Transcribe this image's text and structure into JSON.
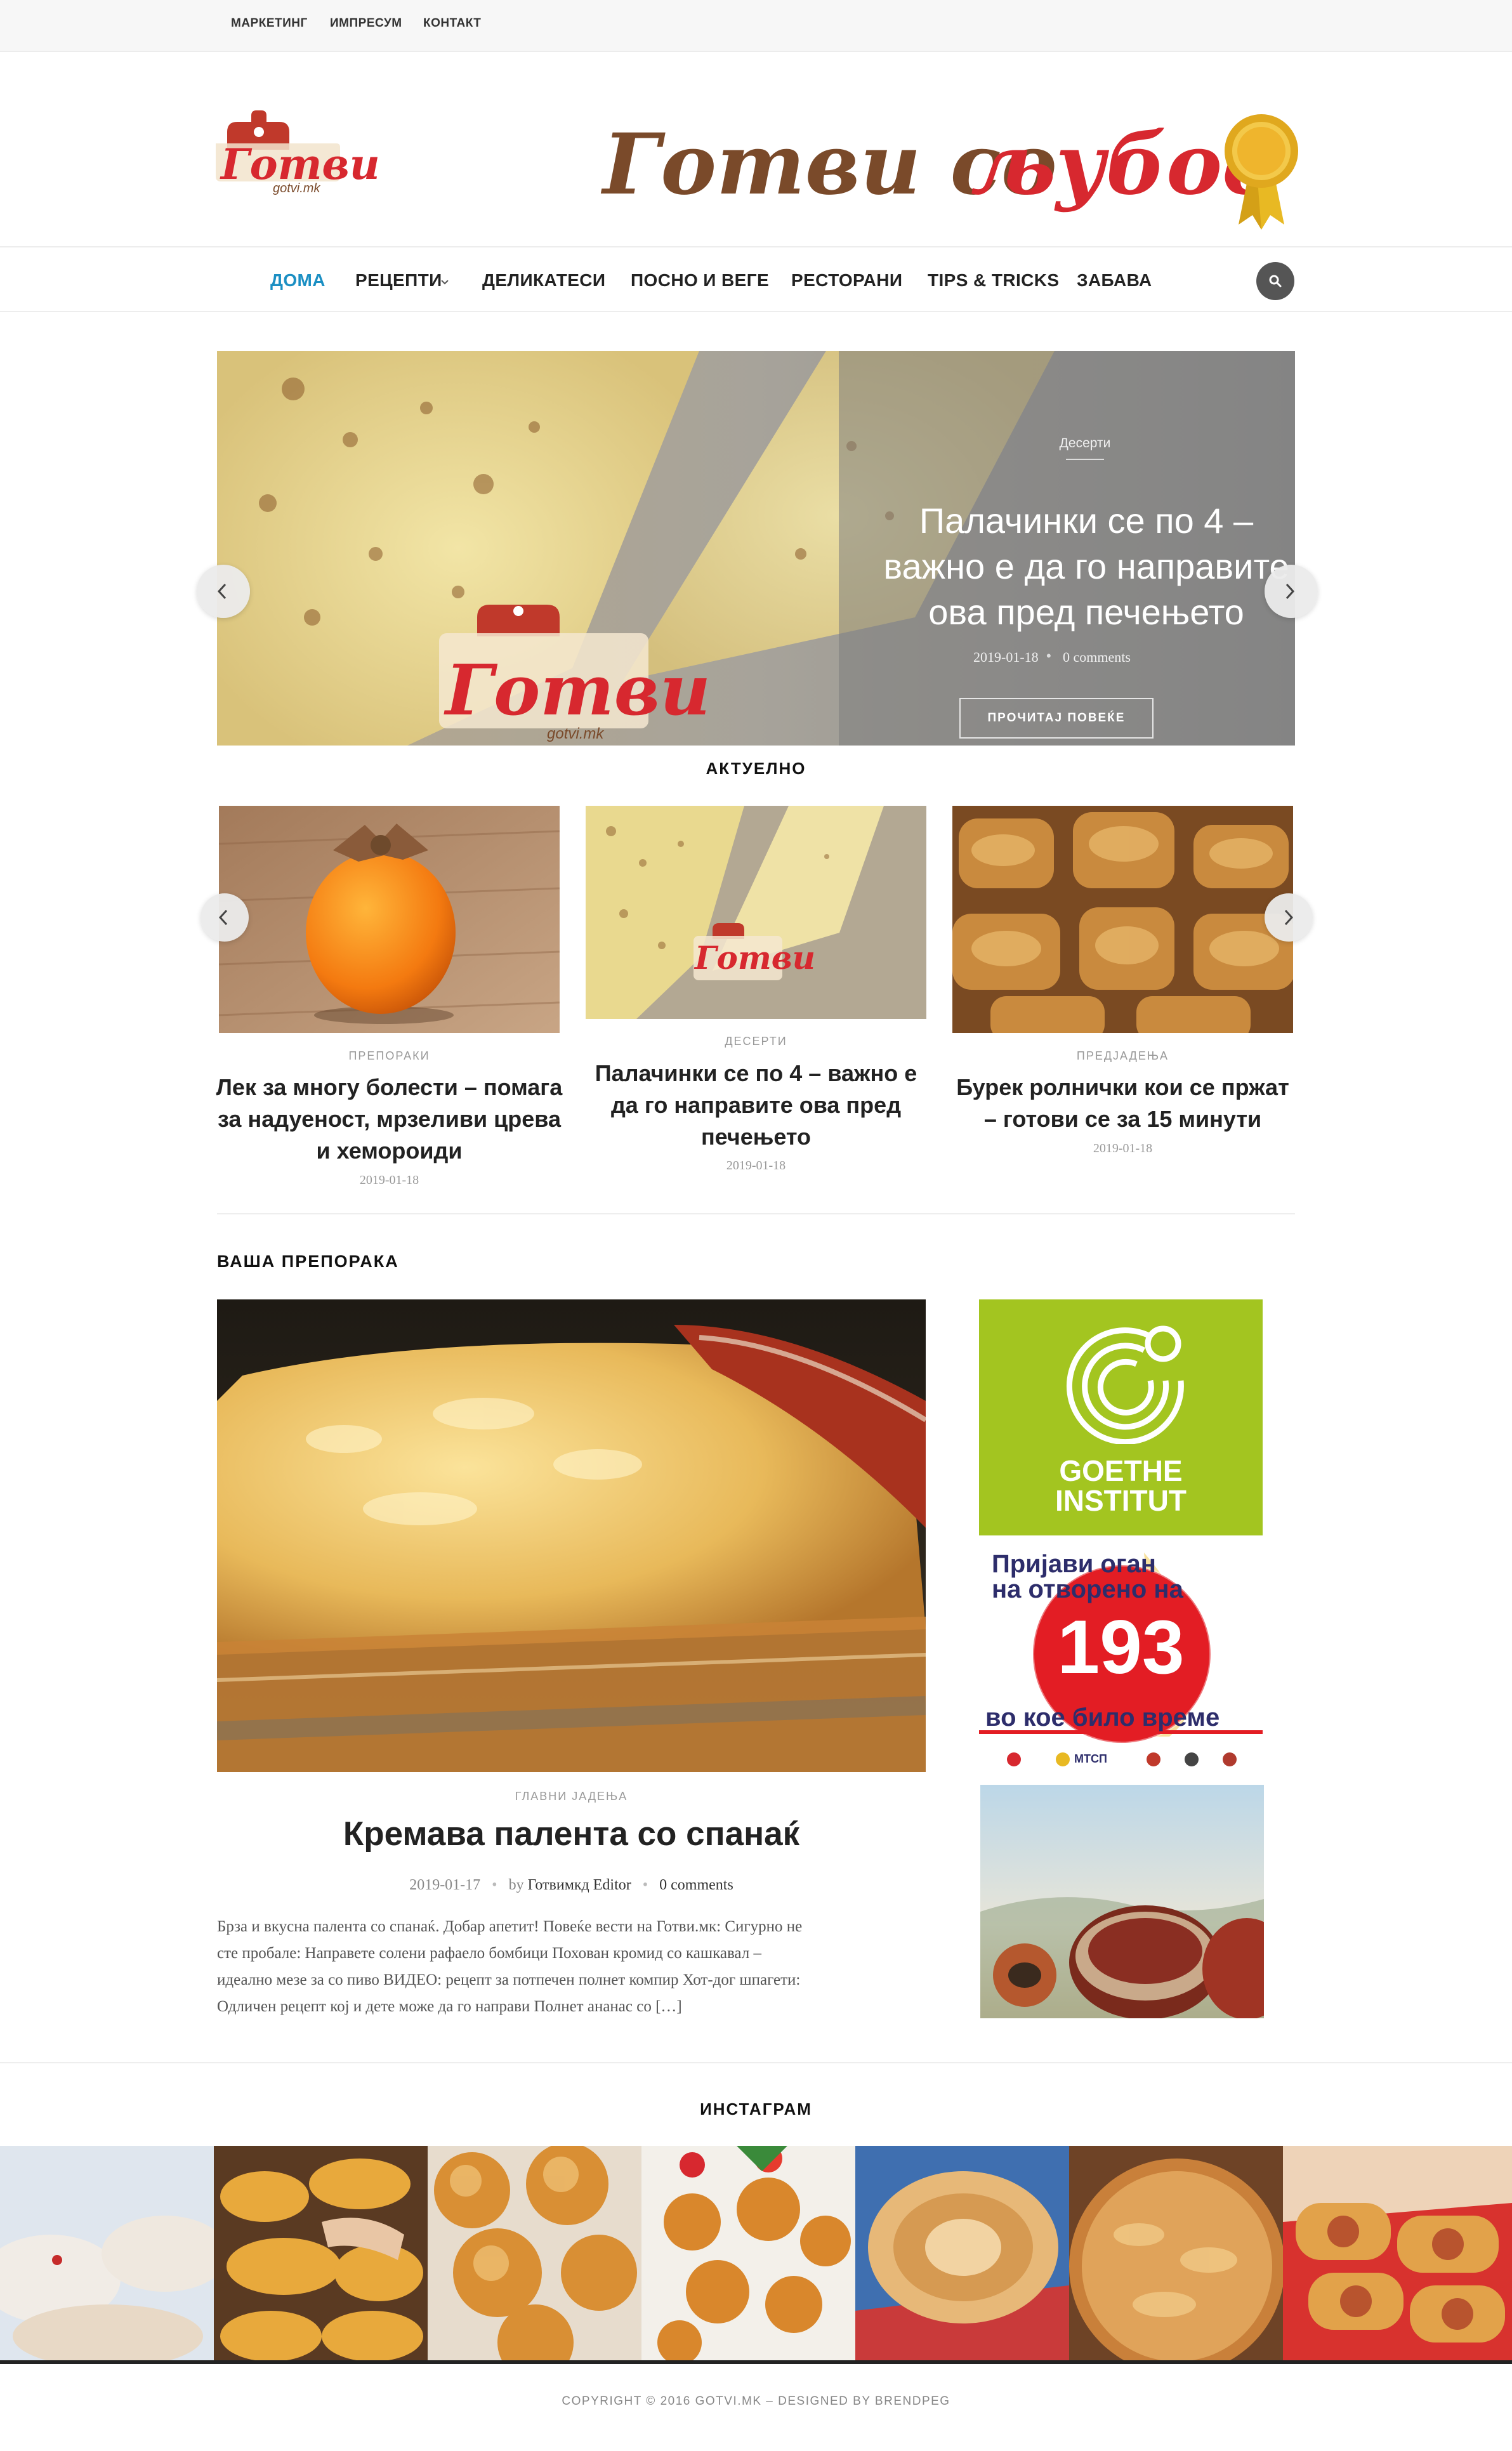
{
  "topbar": {
    "links": [
      "МАРКЕТИНГ",
      "ИМПРЕСУМ",
      "КОНТАКТ"
    ]
  },
  "header": {
    "logo_text": "Готви",
    "logo_sub": "gotvi.mk",
    "banner_part1": "Готви со",
    "banner_part2": "љубов"
  },
  "nav": {
    "items": [
      "ДОМА",
      "РЕЦЕПТИ",
      "ДЕЛИКАТЕСИ",
      "ПОСНО И ВЕГЕ",
      "РЕСТОРАНИ",
      "TIPS & TRICKS",
      "ЗАБАВА"
    ]
  },
  "hero": {
    "category": "Десерти",
    "title_lines": [
      "Палачинки се по 4 –",
      "важно е да го направите",
      "ова пред печењето"
    ],
    "date": "2019-01-18",
    "comments": "0 comments",
    "button": "ПРОЧИТАЈ ПОВЕЌЕ",
    "watermark": "Готви",
    "watermark_sub": "gotvi.mk"
  },
  "aktuelno": {
    "title": "АКТУЕЛНО",
    "cards": [
      {
        "category": "ПРЕПОРАКИ",
        "title_lines": [
          "Лек за многу болести – помага",
          "за надуеност, мрзеливи црева",
          "и хемороиди"
        ],
        "date": "2019-01-18"
      },
      {
        "category": "ДЕСЕРТИ",
        "title_lines": [
          "Палачинки се по 4 – важно е",
          "да го направите ова пред",
          "печењето"
        ],
        "date": "2019-01-18",
        "watermark": "Готви"
      },
      {
        "category": "ПРЕДЈАДЕЊА",
        "title_lines": [
          "Бурек ролнички кои се пржат",
          "– готови се за 15 минути"
        ],
        "date": "2019-01-18"
      }
    ]
  },
  "recommend": {
    "title": "ВАША ПРЕПОРАКА",
    "category": "ГЛАВНИ ЈАДЕЊА",
    "post_title": "Кремава палента со спанаќ",
    "date": "2019-01-17",
    "author_prefix": "by",
    "author": "Готвимкд Editor",
    "comments": "0 comments",
    "excerpt_lines": [
      "Брза и вкусна палента со спанаќ. Добар апетит! Повеќе вести на Готви.мк: Сигурно не",
      "сте пробале: Направете солени рафаело бомбици Похован кромид со кашкавал –",
      "идеално мезе за со пиво ВИДЕО: рецепт за потпечен полнет компир Хот-дог шпагети:",
      "Одличен рецепт кој и дете може да го направи Полнет ананас со […]"
    ]
  },
  "ads": {
    "goethe_line1": "GOETHE",
    "goethe_line2": "INSTITUT",
    "fire_line1": "Пријави оган",
    "fire_line2": "на отворено на",
    "fire_number": "193",
    "fire_line3": "во кое било време",
    "fire_org": "МТСП"
  },
  "instagram": {
    "title": "ИНСТАГРАМ"
  },
  "footer": {
    "copyright": "COPYRIGHT © 2016 GOTVI.MK – DESIGNED BY BRENDPEG"
  },
  "colors": {
    "accent": "#1b8fc3",
    "banner_brown": "#7a4a2a",
    "banner_red": "#d7282f",
    "goethe_green": "#a3c520"
  }
}
